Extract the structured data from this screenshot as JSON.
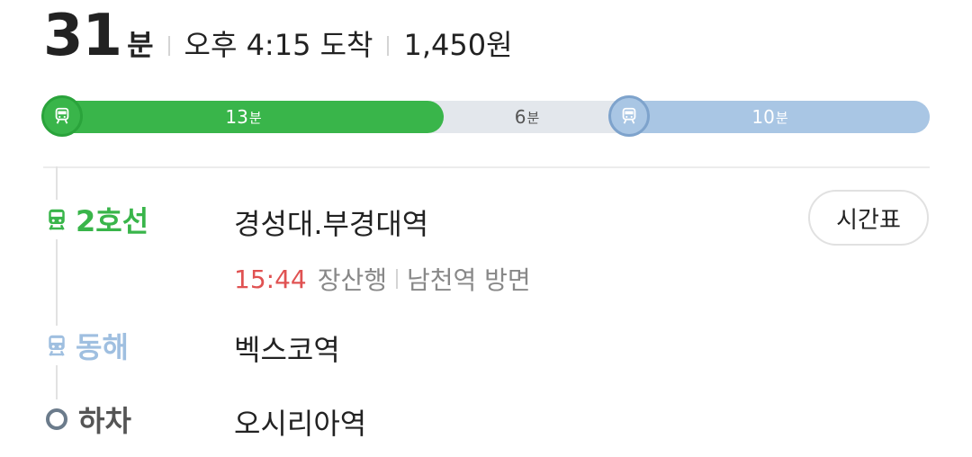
{
  "summary": {
    "duration_value": "31",
    "duration_unit": "분",
    "arrival": "오후 4:15 도착",
    "fare": "1,450원"
  },
  "progress": {
    "segments": [
      {
        "type": "subway",
        "line_color": "#39b54a",
        "minutes": "13",
        "unit": "분"
      },
      {
        "type": "walk",
        "minutes": "6",
        "unit": "분"
      },
      {
        "type": "subway",
        "line_color": "#a9c6e4",
        "minutes": "10",
        "unit": "분"
      }
    ]
  },
  "steps": {
    "line2": {
      "label": "2호선",
      "station": "경성대.부경대역",
      "color": "#39b54a"
    },
    "departure": {
      "time": "15:44",
      "direction": "장산행",
      "platform": "남천역 방면"
    },
    "timetable_button": "시간표",
    "donghae": {
      "label": "동해",
      "station": "벡스코역",
      "color": "#9fbfe0"
    },
    "alight": {
      "label": "하차",
      "station": "오시리아역"
    }
  },
  "icons": {
    "subway": "subway-train-icon",
    "alight": "alight-ring-icon"
  }
}
